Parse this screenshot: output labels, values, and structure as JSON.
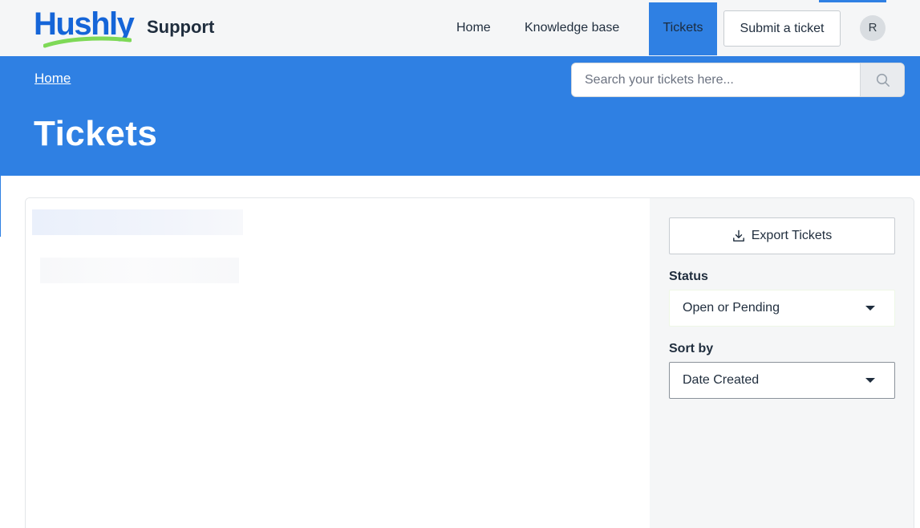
{
  "brand": {
    "logo_text": "Hushly",
    "support_label": "Support"
  },
  "nav": {
    "home": "Home",
    "knowledge_base": "Knowledge base",
    "tickets": "Tickets",
    "submit_ticket": "Submit a ticket",
    "avatar_initial": "R"
  },
  "hero": {
    "breadcrumb": "Home",
    "title": "Tickets",
    "search_placeholder": "Search your tickets here..."
  },
  "sidebar": {
    "export_label": "Export Tickets",
    "status_label": "Status",
    "status_value": "Open or Pending",
    "sort_label": "Sort by",
    "sort_value": "Date Created"
  },
  "icons": {
    "search": "search-icon",
    "download": "download-icon",
    "caret": "caret-down-icon"
  },
  "colors": {
    "primary": "#2f80e3",
    "logo_blue": "#1565d8",
    "logo_green": "#7ed957",
    "text_dark": "#1f2d3d"
  }
}
